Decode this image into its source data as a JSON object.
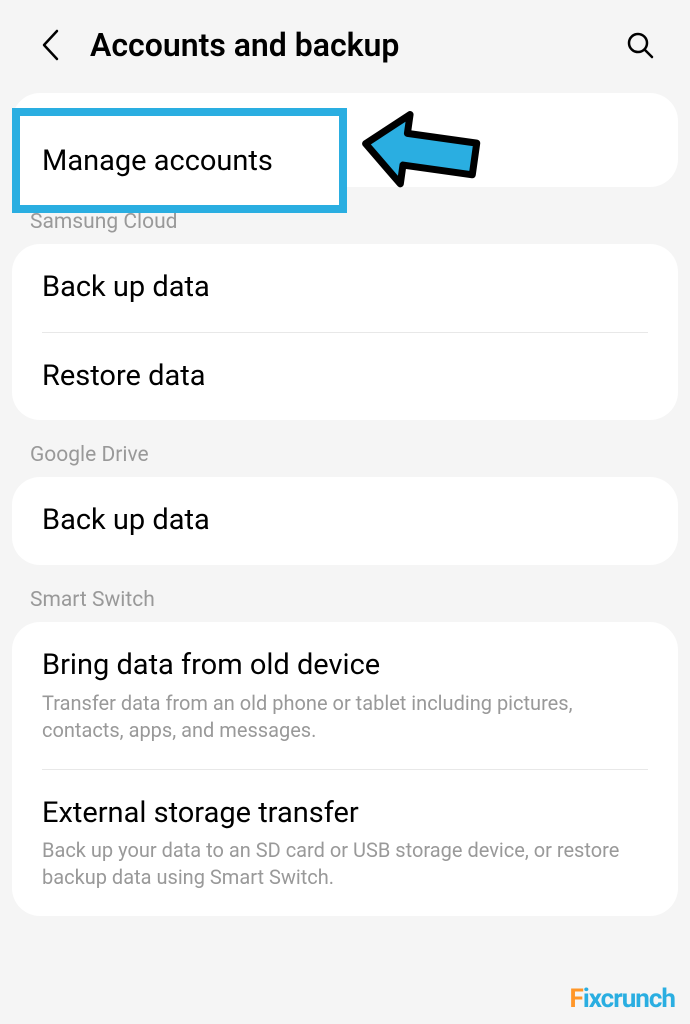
{
  "header": {
    "title": "Accounts and backup"
  },
  "highlighted_item": {
    "label": "Manage accounts"
  },
  "sections": {
    "samsung_cloud": {
      "label": "Samsung Cloud",
      "items": {
        "back_up": "Back up data",
        "restore": "Restore data"
      }
    },
    "google_drive": {
      "label": "Google Drive",
      "items": {
        "back_up": "Back up data"
      }
    },
    "smart_switch": {
      "label": "Smart Switch",
      "items": {
        "bring_data": {
          "title": "Bring data from old device",
          "subtitle": "Transfer data from an old phone or tablet including pictures, contacts, apps, and messages."
        },
        "external_storage": {
          "title": "External storage transfer",
          "subtitle": "Back up your data to an SD card or USB storage device, or restore backup data using Smart Switch."
        }
      }
    }
  },
  "watermark": {
    "first": "F",
    "second": "i",
    "rest": "xcrunch"
  },
  "colors": {
    "highlight_border": "#2aaee1",
    "watermark_accent": "#ff9628"
  }
}
